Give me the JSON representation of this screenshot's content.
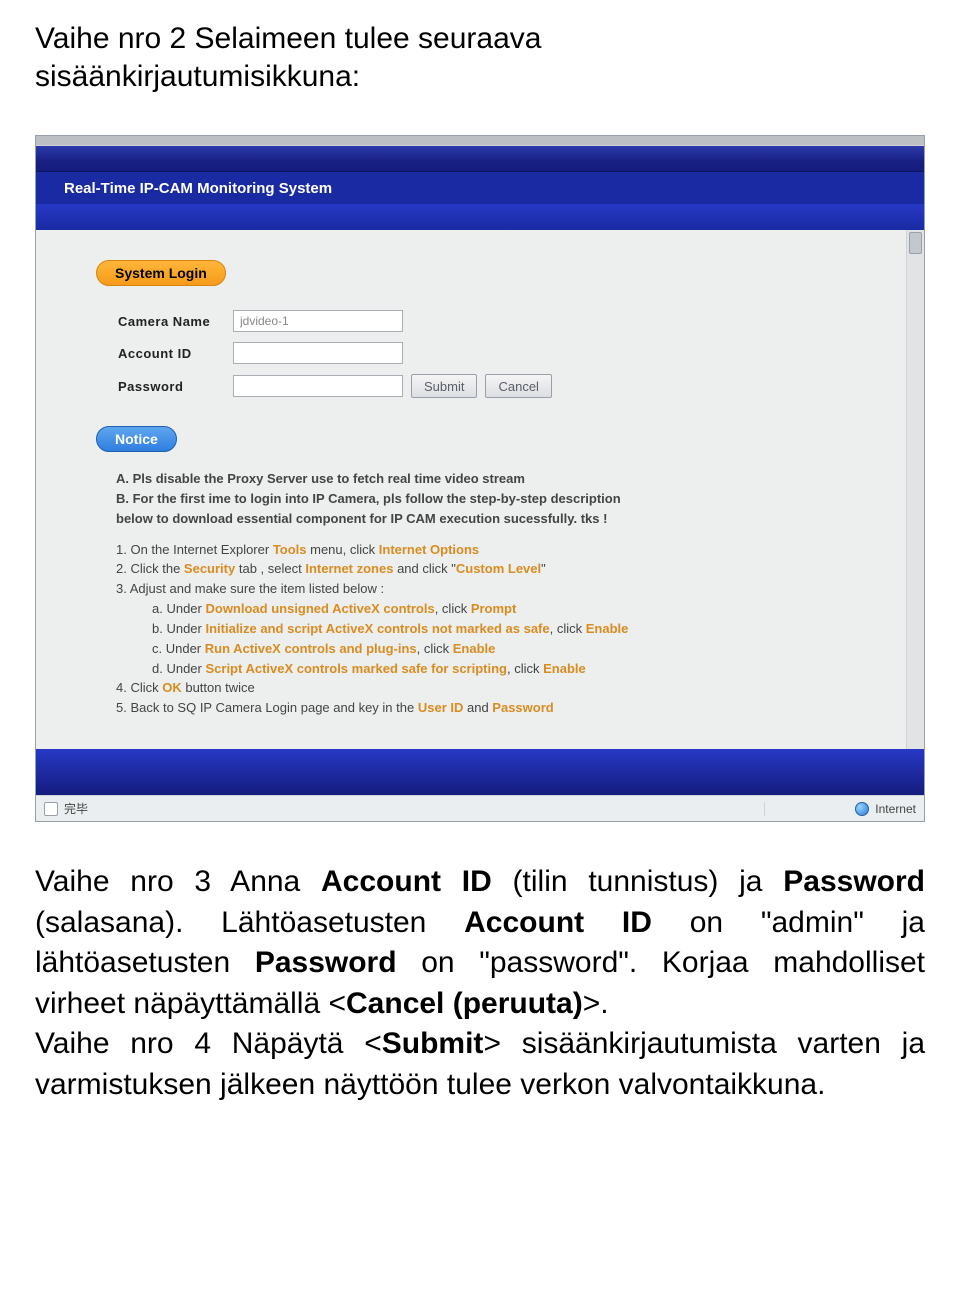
{
  "doc": {
    "heading_a": "Vaihe nro 2 Selaimeen tulee seuraava",
    "heading_b": "sisäänkirjautumisikkuna:",
    "p1_a": "Vaihe nro 3 Anna ",
    "p1_b": "Account ID",
    "p1_c": " (tilin tunnistus) ja ",
    "p1_d": "Password",
    "p1_e": " (salasana). Lähtöasetusten ",
    "p1_f": "Account ID",
    "p1_g": " on \"admin\" ja lähtöasetusten ",
    "p1_h": "Password",
    "p1_i": " on \"password\". Korjaa mahdolliset virheet näpäyttämällä <",
    "p1_j": "Cancel (peruuta)",
    "p1_k": ">.",
    "p2_a": "Vaihe nro 4 Näpäytä <",
    "p2_b": "Submit",
    "p2_c": "> sisäänkirjautumista varten ja varmistuksen jälkeen näyttöön tulee verkon valvontaikkuna."
  },
  "ui": {
    "title": "Real-Time IP-CAM Monitoring System",
    "pill_login": "System Login",
    "pill_notice": "Notice",
    "labels": {
      "camera": "Camera Name",
      "account": "Account ID",
      "password": "Password"
    },
    "camera_value": "jdvideo-1",
    "buttons": {
      "submit": "Submit",
      "cancel": "Cancel"
    },
    "notice": {
      "a": "A. Pls disable the Proxy Server use to fetch real time video stream",
      "b1": "B. For the first ime to login into IP Camera, pls follow the step-by-step description",
      "b2": "below to download essential component for IP CAM execution sucessfully. tks !",
      "s1_pre": "1. On the Internet Explorer ",
      "s1_h1": "Tools",
      "s1_mid": " menu, click ",
      "s1_h2": "Internet Options",
      "s2_pre": "2. Click the ",
      "s2_h1": "Security",
      "s2_mid": " tab , select ",
      "s2_h2": "Internet zones",
      "s2_mid2": " and click \"",
      "s2_h3": "Custom Level",
      "s2_end": "\"",
      "s3": "3. Adjust and make sure the item listed below :",
      "s3a_pre": "a. Under ",
      "s3a_h1": "Download unsigned ActiveX controls",
      "s3a_mid": ", click ",
      "s3a_h2": "Prompt",
      "s3b_pre": "b. Under ",
      "s3b_h1": "Initialize and script ActiveX controls not marked as safe",
      "s3b_mid": ", click ",
      "s3b_h2": "Enable",
      "s3c_pre": "c. Under ",
      "s3c_h1": "Run ActiveX controls and plug-ins",
      "s3c_mid": ", click ",
      "s3c_h2": "Enable",
      "s3d_pre": "d. Under ",
      "s3d_h1": "Script ActiveX controls marked safe for scripting",
      "s3d_mid": ", click ",
      "s3d_h2": "Enable",
      "s4_pre": "4. Click ",
      "s4_h": "OK",
      "s4_end": " button twice",
      "s5_pre": "5. Back to SQ IP Camera Login page and key in the ",
      "s5_h1": "User ID",
      "s5_mid": " and ",
      "s5_h2": "Password"
    },
    "status_left": "完毕",
    "status_right": "Internet"
  }
}
